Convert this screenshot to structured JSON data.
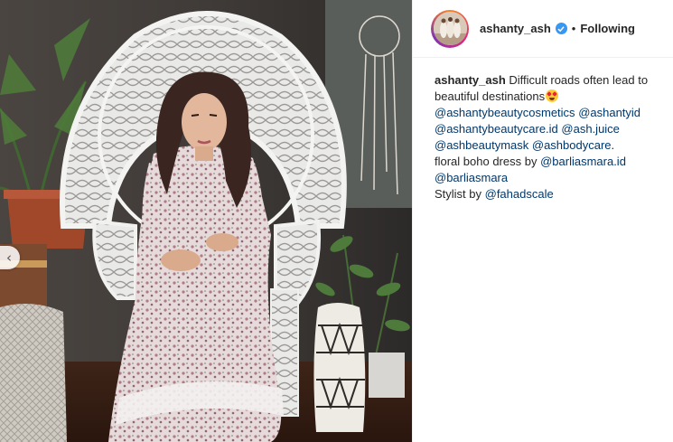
{
  "post": {
    "image_alt": "Woman in floral boho dress sitting on white wicker peacock chair",
    "author": {
      "username": "ashanty_ash",
      "verified": true,
      "separator": "•",
      "follow_status": "Following"
    },
    "caption": {
      "username": "ashanty_ash",
      "text_lead": " Difficult roads often lead to beautiful destinations",
      "emoji": "star-struck-emoji",
      "mentions_1": [
        "@ashantybeautycosmetics",
        "@ashantyid",
        "@ashantybeautycare.id",
        "@ash.juice",
        "@ashbeautymask",
        "@ashbodycare"
      ],
      "line_dress_lead": "floral boho dress by ",
      "dress_mentions": [
        "@barliasmara.id",
        "@barliasmara"
      ],
      "stylist_lead": "Stylist by ",
      "stylist_mention": "@fahadscale",
      "period": "."
    }
  },
  "controls": {
    "prev_icon": "‹"
  },
  "colors": {
    "mention": "#00376b",
    "verified": "#3897f0",
    "text": "#262626",
    "border": "#efefef"
  }
}
